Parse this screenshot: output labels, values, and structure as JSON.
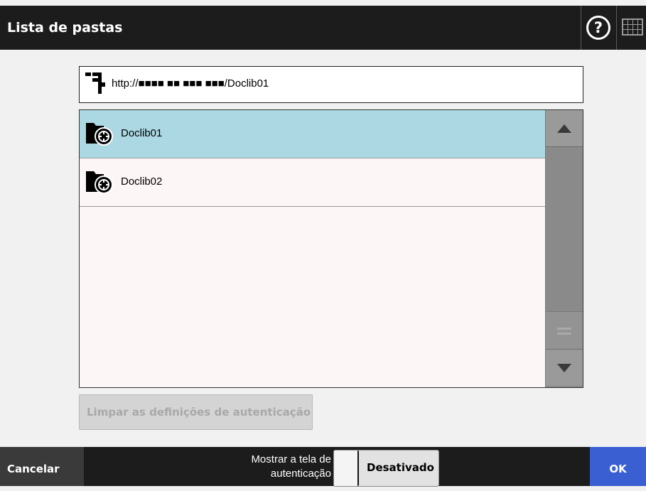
{
  "header": {
    "title": "Lista de pastas",
    "help_label": "?",
    "help_icon": "help-icon",
    "keyboard_icon": "keyboard-icon"
  },
  "path": {
    "icon": "network-icon",
    "url": "http://■■■■ ■■ ■■■ ■■■/Doclib01"
  },
  "folders": {
    "items": [
      {
        "label": "Doclib01",
        "selected": true,
        "icon": "sharepoint-folder-icon"
      },
      {
        "label": "Doclib02",
        "selected": false,
        "icon": "sharepoint-folder-icon"
      }
    ]
  },
  "scrollbar": {
    "up_icon": "arrow-up-icon",
    "down_icon": "arrow-down-icon"
  },
  "clear_auth": {
    "label": "Limpar as definições de autenticação",
    "enabled": false
  },
  "footer": {
    "cancel_label": "Cancelar",
    "auth_label_line1": "Mostrar a tela de",
    "auth_label_line2": "autenticação",
    "toggle_value": "Desativado",
    "ok_label": "OK"
  },
  "colors": {
    "header_bg": "#1c1c1c",
    "selected_row": "#acd8e3",
    "list_bg": "#fdf6f6",
    "ok_button": "#3a5fd2",
    "cancel_button": "#3a3a3a"
  }
}
